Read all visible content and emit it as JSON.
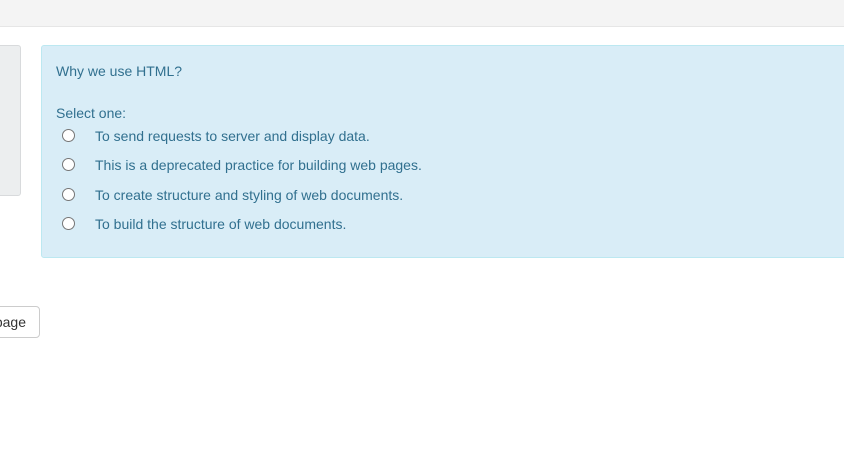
{
  "question": {
    "text": "Why we use HTML?",
    "prompt": "Select one:",
    "answers": [
      "To send requests to server and display data.",
      "This is a deprecated practice for building web pages.",
      "To create structure and styling of web documents.",
      "To build the structure of web documents."
    ]
  },
  "navigation": {
    "page_button_label": "page"
  },
  "colors": {
    "info_background": "#d9edf7",
    "info_border": "#bce8f1",
    "info_text": "#31708f"
  }
}
